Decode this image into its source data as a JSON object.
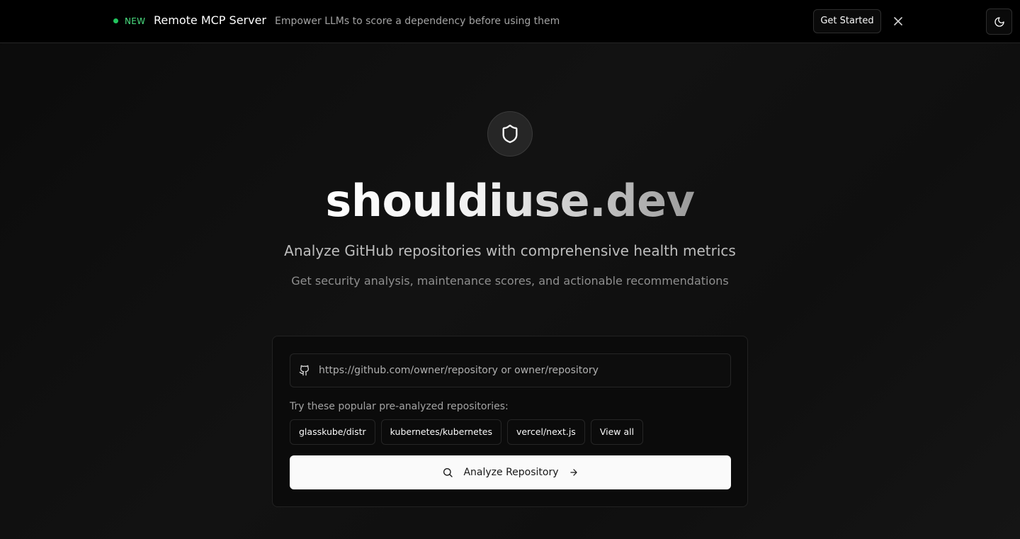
{
  "banner": {
    "badge": "NEW",
    "title": "Remote MCP Server",
    "description": "Empower LLMs to score a dependency before using them",
    "cta_label": "Get Started",
    "status_color": "#22c55e"
  },
  "header": {
    "theme_toggle_icon": "moon-icon",
    "close_icon": "close-icon"
  },
  "hero": {
    "logo_icon": "shield-icon",
    "title": "shouldiuse.dev",
    "subtitle": "Analyze GitHub repositories with comprehensive health metrics",
    "tagline": "Get security analysis, maintenance scores, and actionable recommendations"
  },
  "search": {
    "icon": "github-icon",
    "value": "",
    "placeholder": "https://github.com/owner/repository or owner/repository",
    "popular_label": "Try these popular pre-analyzed repositories:",
    "popular": [
      "glasskube/distr",
      "kubernetes/kubernetes",
      "vercel/next.js",
      "View all"
    ],
    "submit_label": "Analyze Repository",
    "submit_leading_icon": "search-icon",
    "submit_trailing_icon": "arrow-right-icon"
  }
}
